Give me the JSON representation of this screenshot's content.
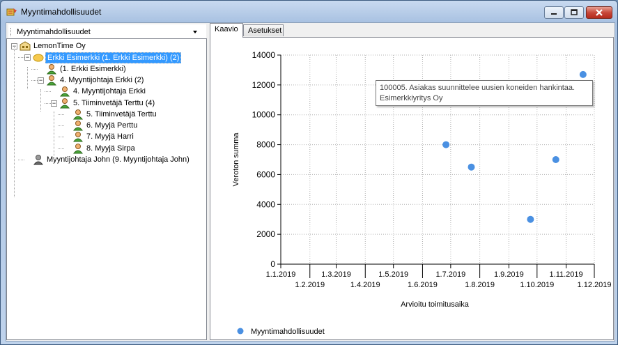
{
  "window": {
    "title": "Myyntimahdollisuudet"
  },
  "left": {
    "combo_value": "Myyntimahdollisuudet",
    "tree": [
      {
        "label": "LemonTime Oy",
        "icon": "company-icon",
        "selected": false
      },
      {
        "label": "Erkki Esimerkki (1. Erkki Esimerkki) (2)",
        "icon": "group-icon",
        "selected": true
      },
      {
        "label": "(1. Erkki Esimerkki)",
        "icon": "person-icon",
        "selected": false
      },
      {
        "label": "4. Myyntijohtaja Erkki (2)",
        "icon": "person-icon",
        "selected": false
      },
      {
        "label": "4. Myyntijohtaja Erkki",
        "icon": "person-icon",
        "selected": false
      },
      {
        "label": "5. Tiiminvetäjä Terttu (4)",
        "icon": "person-icon",
        "selected": false
      },
      {
        "label": "5. Tiiminvetäjä Terttu",
        "icon": "person-icon",
        "selected": false
      },
      {
        "label": "6. Myyjä Perttu",
        "icon": "person-icon",
        "selected": false
      },
      {
        "label": "7. Myyjä Harri",
        "icon": "person-icon",
        "selected": false
      },
      {
        "label": "8. Myyjä Sirpa",
        "icon": "person-icon",
        "selected": false
      },
      {
        "label": "Myyntijohtaja John (9. Myyntijohtaja John)",
        "icon": "person-grey-icon",
        "selected": false
      }
    ]
  },
  "tabs": [
    {
      "label": "Kaavio",
      "active": true
    },
    {
      "label": "Asetukset",
      "active": false
    }
  ],
  "tooltip": {
    "line1": "100005. Asiakas suunnittelee uusien koneiden hankintaa.",
    "line2": "Esimerkkiyritys Oy"
  },
  "colors": {
    "point": "#4a90e2",
    "selection": "#3399ff"
  },
  "chart_data": {
    "type": "scatter",
    "xlabel": "Arvioitu toimitusaika",
    "ylabel": "Veroton summa",
    "ylim": [
      0,
      14000
    ],
    "xlim": [
      "2019-01-01",
      "2019-12-01"
    ],
    "y_ticks": [
      "0",
      "2000",
      "4000",
      "6000",
      "8000",
      "10000",
      "12000",
      "14000"
    ],
    "x_ticks": [
      "1.1.2019",
      "1.2.2019",
      "1.3.2019",
      "1.4.2019",
      "1.5.2019",
      "1.6.2019",
      "1.7.2019",
      "1.8.2019",
      "1.9.2019",
      "1.10.2019",
      "1.11.2019",
      "1.12.2019"
    ],
    "grid": true,
    "legend_position": "bottom-left",
    "series": [
      {
        "name": "Myyntimahdollisuudet",
        "points": [
          {
            "x": "2019-06-26",
            "y": 8000
          },
          {
            "x": "2019-07-23",
            "y": 6500
          },
          {
            "x": "2019-09-24",
            "y": 3000
          },
          {
            "x": "2019-10-21",
            "y": 7000
          },
          {
            "x": "2019-11-19",
            "y": 12700
          }
        ]
      }
    ]
  }
}
